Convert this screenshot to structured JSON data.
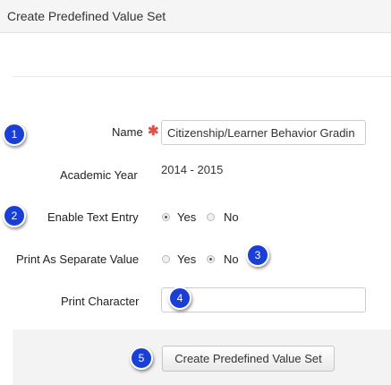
{
  "header": {
    "title": "Create Predefined Value Set"
  },
  "form": {
    "name": {
      "label": "Name",
      "required_mark": "✱",
      "value": "Citizenship/Learner Behavior Gradin"
    },
    "academic_year": {
      "label": "Academic Year",
      "value": "2014 - 2015"
    },
    "enable_text_entry": {
      "label": "Enable Text Entry",
      "yes": "Yes",
      "no": "No",
      "selected": "Yes"
    },
    "print_separate": {
      "label": "Print As Separate Value",
      "yes": "Yes",
      "no": "No",
      "selected": "No"
    },
    "print_character": {
      "label": "Print Character",
      "value": ""
    }
  },
  "footer": {
    "submit_label": "Create Predefined Value Set"
  },
  "callouts": [
    "1",
    "2",
    "3",
    "4",
    "5"
  ],
  "colors": {
    "callout": "#1a3fd6",
    "required": "#d9534f"
  }
}
